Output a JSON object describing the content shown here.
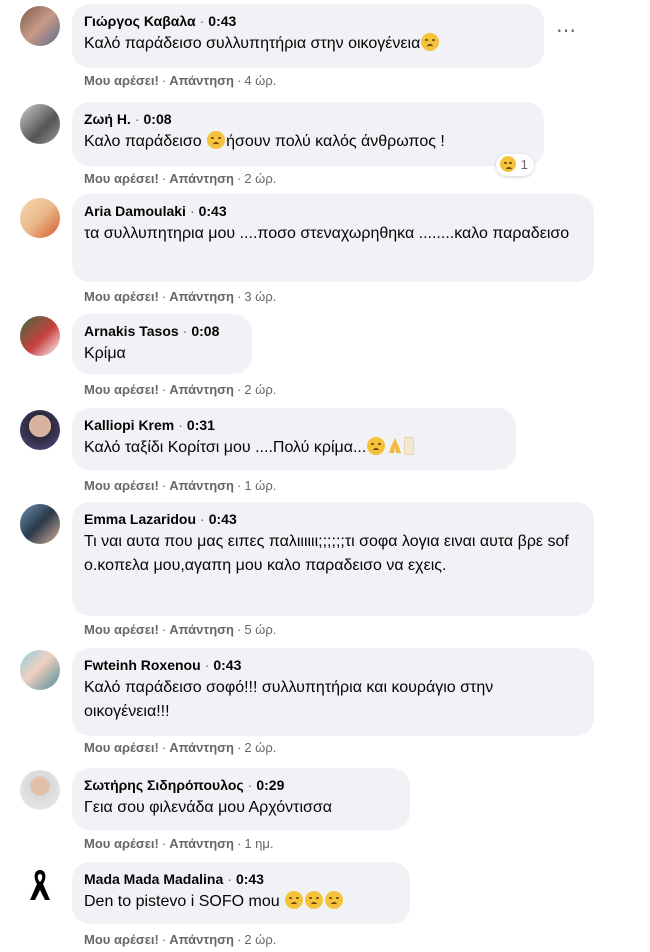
{
  "labels": {
    "like": "Μου αρέσει!",
    "reply": "Απάντηση",
    "separator": "·"
  },
  "colors": {
    "bubble": "#f0f2f5",
    "meta": "#65676b",
    "emoji": "#f5c33b"
  },
  "more_options": "⋯",
  "comments": [
    {
      "author": "Γιώργος Καβαλα",
      "time": "0:43",
      "text": "Καλό παράδεισο συλλυπητήρια στην οικογένεια",
      "emoji": "pensive",
      "ago": "4 ώρ."
    },
    {
      "author": "Ζωή Η.",
      "time": "0:08",
      "text_a": "Καλο παράδεισο",
      "text_b": "ήσουν πολύ καλός άνθρωπος !",
      "ago": "2 ώρ.",
      "reaction_count": "1"
    },
    {
      "author": "Aria Damoulaki",
      "time": "0:43",
      "text": "τα συλλυπητηρια μου ....ποσο στεναχωρηθηκα ........καλο παραδεισο",
      "ago": "3 ώρ."
    },
    {
      "author": "Arnakis Tasos",
      "time": "0:08",
      "text": "Κρίμα",
      "ago": "2 ώρ."
    },
    {
      "author": "Kalliopi Krem",
      "time": "0:31",
      "text": "Καλό ταξίδι Κορίτσι μου ....Πολύ κρίμα...",
      "ago": "1 ώρ."
    },
    {
      "author": "Emma Lazaridou",
      "time": "0:43",
      "text": "Τι ναι αυτα που μας ειπες παλιιιιιι;;;;;;τι σοφα λογια ειναι αυτα βρε sofo.κοπελα μου,αγαπη μου καλο παραδεισο να εχεις.",
      "ago": "5 ώρ."
    },
    {
      "author": "Fwteinh Roxenou",
      "time": "0:43",
      "text": "Καλό παράδεισο σοφό!!! συλλυπητήρια και κουράγιο στην οικογένεια!!!",
      "ago": "2 ώρ."
    },
    {
      "author": "Σωτήρης Σιδηρόπουλος",
      "time": "0:29",
      "text": "Γεια σου φιλενάδα μου Αρχόντισσα",
      "ago": "1 ημ."
    },
    {
      "author": "Mada Mada Madalina",
      "time": "0:43",
      "text": "Den to pistevo i SOFO mou",
      "ago": "2 ώρ."
    }
  ]
}
